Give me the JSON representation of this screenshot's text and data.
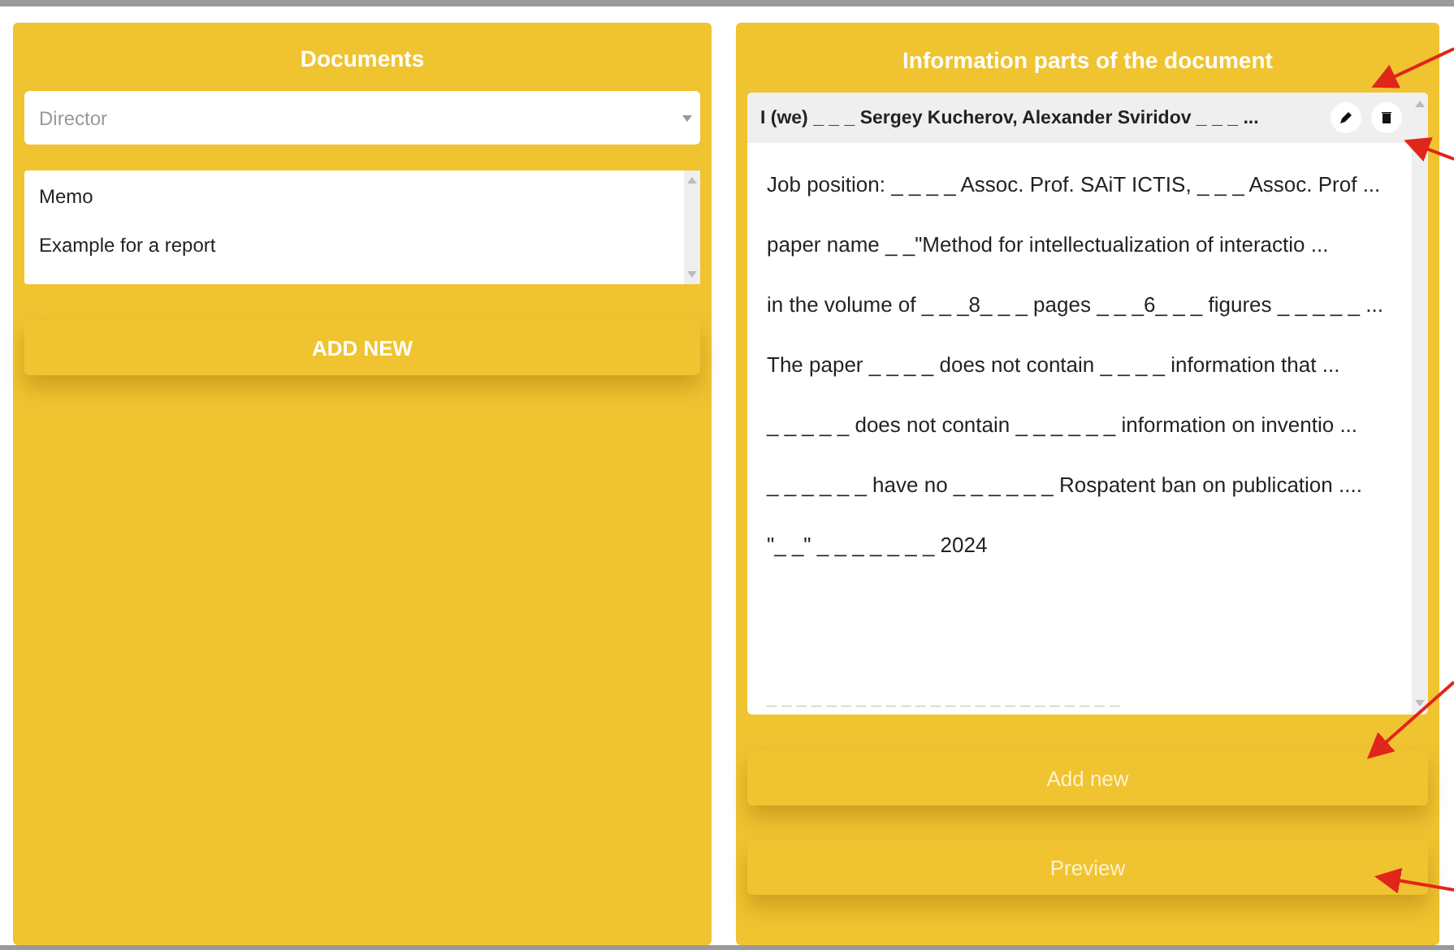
{
  "documents_panel": {
    "title": "Documents",
    "select": {
      "placeholder": "Director"
    },
    "list": [
      {
        "label": "Memo",
        "selected": false
      },
      {
        "label": "Example for a report",
        "selected": false
      }
    ],
    "add_button": "ADD NEW"
  },
  "parts_panel": {
    "title": "Information parts of the document",
    "parts": [
      {
        "kind": "header",
        "text": "I (we) _ _ _ Sergey Kucherov, Alexander Sviridov _ _ _  ..."
      },
      {
        "kind": "line",
        "text": "Job position: _ _ _ _ Assoc. Prof. SAiT ICTIS, _ _ _ Assoc. Prof  ..."
      },
      {
        "kind": "line",
        "text": "paper name _ _\"Method for intellectualization of interactio  ..."
      },
      {
        "kind": "line",
        "text": "in the volume of _ _ _8_ _ _ pages _ _ _6_ _ _ figures _ _ _ _ _ ..."
      },
      {
        "kind": "line",
        "text": "The paper _ _ _ _ does not contain _ _ _ _ information that   ..."
      },
      {
        "kind": "line",
        "text": "_ _ _ _ _ does not contain _ _ _ _ _ _ information on inventio ..."
      },
      {
        "kind": "line",
        "text": "_ _ _ _ _ _ have no _ _ _ _ _ _ Rospatent ban on publication  ...."
      },
      {
        "kind": "line",
        "text": "\"_ _\" _ _ _ _ _ _ _ 2024"
      },
      {
        "kind": "faint",
        "text": "_ _ _ _ _   _ _ _ _ _ _ _ _ _ _ _ _ _ _ _ _ _ _ _"
      }
    ],
    "buttons": [
      "Add new",
      "Preview"
    ]
  }
}
